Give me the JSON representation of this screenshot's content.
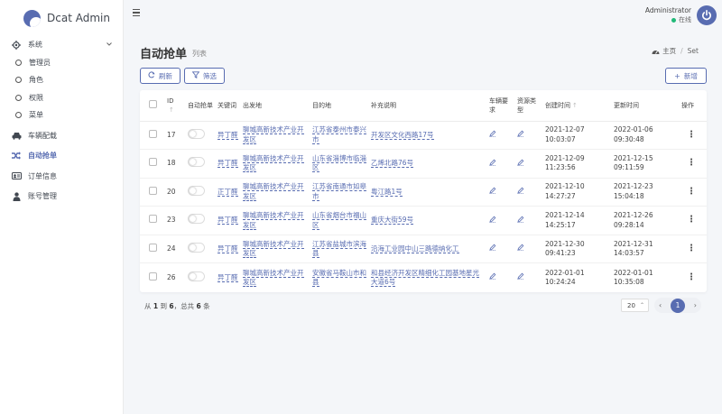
{
  "brand": {
    "name": "Dcat Admin"
  },
  "sidebar": {
    "items": [
      {
        "label": "系统",
        "icon": "gear-icon"
      },
      {
        "label": "管理员"
      },
      {
        "label": "角色"
      },
      {
        "label": "权限"
      },
      {
        "label": "菜单"
      },
      {
        "label": "车辆配载",
        "icon": "car-icon"
      },
      {
        "label": "自动抢单",
        "icon": "shuffle-icon"
      },
      {
        "label": "订单信息",
        "icon": "id-card-icon"
      },
      {
        "label": "账号管理",
        "icon": "user-icon"
      }
    ]
  },
  "navbar": {
    "user_name": "Administrator",
    "user_status": "在线"
  },
  "header": {
    "title": "自动抢单",
    "subtitle": "列表",
    "breadcrumb_home": "主页",
    "breadcrumb_current": "Set"
  },
  "toolbar": {
    "refresh_label": "刷新",
    "filter_label": "筛选",
    "add_label": "新增"
  },
  "table": {
    "headers": {
      "id": "ID",
      "auto": "自动抢单",
      "keyword": "关键词",
      "origin": "出发地",
      "destination": "目的地",
      "note": "补充说明",
      "vehicle": "车辆要求",
      "resource": "资源类型",
      "created": "创建时间",
      "updated": "更新时间",
      "actions": "操作"
    },
    "rows": [
      {
        "id": "17",
        "keyword": "异丁醛",
        "origin": "聊城高新技术产业开发区",
        "destination": "江苏省泰州市泰兴市",
        "note": "开发区文化西路17号",
        "created": "2021-12-07 10:03:07",
        "updated": "2022-01-06 09:30:48"
      },
      {
        "id": "18",
        "keyword": "异丁醛",
        "origin": "聊城高新技术产业开发区",
        "destination": "山东省淄博市临淄区",
        "note": "乙烯北路76号",
        "created": "2021-12-09 11:23:56",
        "updated": "2021-12-15 09:11:59"
      },
      {
        "id": "20",
        "keyword": "正丁醛",
        "origin": "聊城高新技术产业开发区",
        "destination": "江苏省南通市如皋市",
        "note": "粤江路1号",
        "created": "2021-12-10 14:27:27",
        "updated": "2021-12-23 15:04:18"
      },
      {
        "id": "23",
        "keyword": "异丁醛",
        "origin": "聊城高新技术产业开发区",
        "destination": "山东省烟台市福山区",
        "note": "重庆大街59号",
        "created": "2021-12-14 14:25:17",
        "updated": "2021-12-26 09:28:14"
      },
      {
        "id": "24",
        "keyword": "异丁醛",
        "origin": "聊城高新技术产业开发区",
        "destination": "江苏省盐城市滨海县",
        "note": "沿海工业园中山三路德纳化工",
        "created": "2021-12-30 09:41:23",
        "updated": "2021-12-31 14:03:57"
      },
      {
        "id": "26",
        "keyword": "异丁醛",
        "origin": "聊城高新技术产业开发区",
        "destination": "安徽省马鞍山市和县",
        "note": "和县经济开发区精细化工园基地星光大道6号",
        "created": "2022-01-01 10:24:24",
        "updated": "2022-01-01 10:35:08"
      }
    ]
  },
  "footer": {
    "summary_prefix": "从",
    "summary_from": "1",
    "summary_to_word": "到",
    "summary_to": "6",
    "summary_total_word": "，总共",
    "summary_total": "6",
    "summary_suffix": "条",
    "per_page": "20",
    "current_page": "1"
  },
  "colors": {
    "accent": "#586cb1",
    "online": "#21b978"
  }
}
